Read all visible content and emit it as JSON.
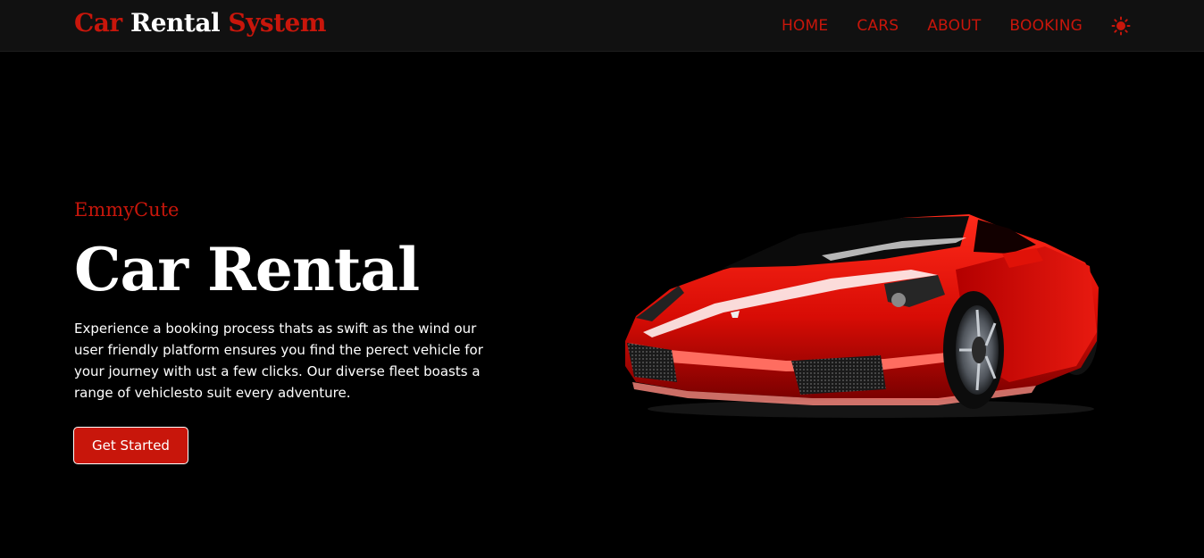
{
  "colors": {
    "accent": "#c8160b",
    "background": "#000000",
    "navbar": "#111111",
    "text": "#ffffff"
  },
  "navbar": {
    "logo": {
      "word1": "Car",
      "word2": "Rental",
      "word3": "System"
    },
    "links": {
      "home": "HOME",
      "cars": "CARS",
      "about": "ABOUT",
      "booking": "BOOKING"
    },
    "theme_icon": "sun-icon"
  },
  "hero": {
    "subtitle": "EmmyCute",
    "title": "Car Rental",
    "description": "Experience a booking process thats as swift as the wind our user friendly platform ensures you find the perect vehicle for your journey with ust a few clicks. Our diverse fleet boasts a range of vehiclesto suit every adventure.",
    "cta_label": "Get Started",
    "image": "red-sports-car-image"
  }
}
